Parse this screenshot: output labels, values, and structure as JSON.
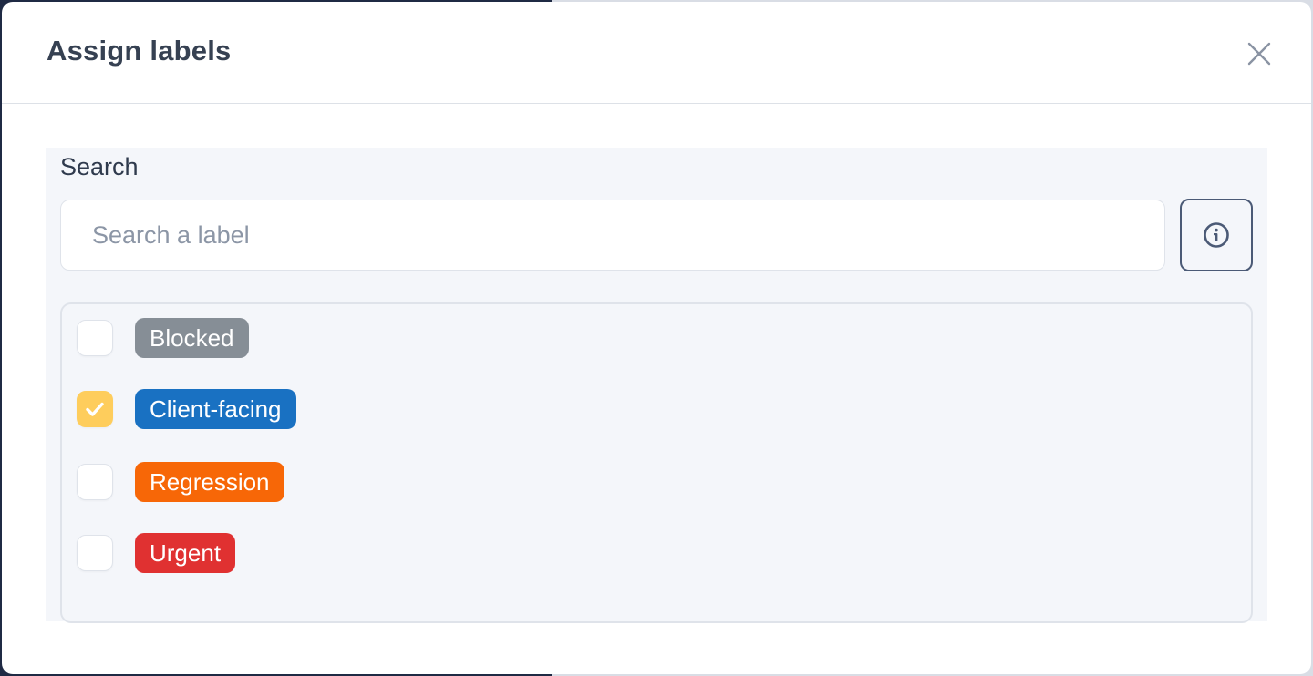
{
  "modal": {
    "title": "Assign labels",
    "close_icon": "close-icon"
  },
  "search": {
    "label": "Search",
    "placeholder": "Search a label",
    "value": "",
    "info_icon": "info-icon"
  },
  "labels": [
    {
      "name": "Blocked",
      "color": "#868e96",
      "checked": false
    },
    {
      "name": "Client-facing",
      "color": "#1971c2",
      "checked": true
    },
    {
      "name": "Regression",
      "color": "#f76707",
      "checked": false
    },
    {
      "name": "Urgent",
      "color": "#e03131",
      "checked": false
    }
  ],
  "colors": {
    "checkbox_checked": "#fecd5c",
    "title_text": "#364152"
  }
}
